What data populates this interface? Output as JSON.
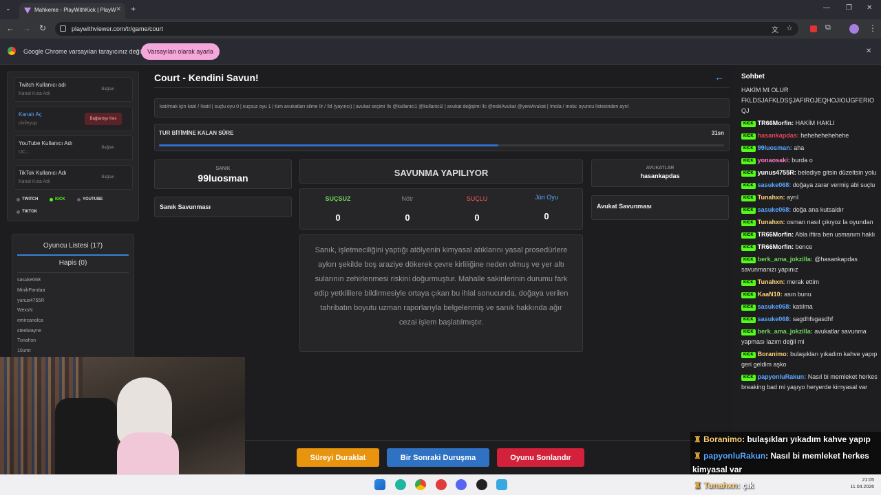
{
  "browser": {
    "tab_title": "Mahkeme - PlayWithKick | PlayW",
    "url": "playwithviewer.com/tr/game/court",
    "info_text": "Google Chrome varsayılan tarayıcınız değil",
    "set_default_label": "Varsayılan olarak ayarla"
  },
  "accounts": [
    {
      "title": "Twitch Kullanıcı adı",
      "sub": "Kanal Kısa Adı",
      "action": "Bağlan"
    },
    {
      "title": "Kanalı Aç",
      "sub": "civileyup",
      "action": "Bağlantıyı Kes"
    },
    {
      "title": "YouTube Kullanıcı Adı",
      "sub": "UC...",
      "action": "Bağlan"
    },
    {
      "title": "TikTok Kullanıcı Adı",
      "sub": "Kanal Kısa Adı",
      "action": "Bağlan"
    }
  ],
  "platforms": [
    "TWITCH",
    "KICK",
    "YOUTUBE",
    "TIKTOK"
  ],
  "players": {
    "list_label": "Oyuncu Listesi (17)",
    "jail_label": "Hapis (0)",
    "names": [
      "sasuke068",
      "MinikPandaa",
      "yunus4755R",
      "WexsN",
      "emircanolca",
      "steelwayne",
      "Tunahsn",
      "10umt"
    ]
  },
  "court": {
    "title": "Court - Kendini Savun!",
    "commands": "katılmak için katıl / !katıl | suçlu oyu 0 | suçsuz oyu 1 | tüm avukatları silme !lr / !ld (yayıncı) | avukat seçimi !ls @kullanici1 @kullanici2 | avukat değişimi !lc @eskiAvukat @yeniAvukat | !mola / mola: oyuncu listesinden ayrıl",
    "timer_label": "TUR BİTİMİNE KALAN SÜRE",
    "timer_value": "31sn",
    "timer_progress": 0.6,
    "defendant_label": "SANIK",
    "defendant_name": "99luosman",
    "defendant_defense": "Sanık Savunması",
    "phase": "SAVUNMA YAPILIYOR",
    "votes": [
      {
        "label": "SUÇSUZ",
        "value": "0",
        "color": "#6fd35a"
      },
      {
        "label": "Nötr",
        "value": "0",
        "color": "#888888"
      },
      {
        "label": "SUÇLU",
        "value": "0",
        "color": "#ff5a5a"
      },
      {
        "label": "Jüri Oyu",
        "value": "0",
        "color": "#5aa8ff"
      }
    ],
    "lawyers_label": "AVUKATLAR",
    "lawyer_name": "hasankapdas",
    "lawyer_defense": "Avukat Savunması",
    "case_text": "Sanık, işletmeciliğini yaptığı atölyenin kimyasal atıklarını yasal prosedürlere aykırı şekilde boş araziye dökerek çevre kirliliğine neden olmuş ve yer altı sularının zehirlenmesi riskini doğurmuştur. Mahalle sakinlerinin durumu fark edip yetkililere bildirmesiyle ortaya çıkan bu ihlal sonucunda, doğaya verilen tahribatın boyutu uzman raporlarıyla belgelenmiş ve sanık hakkında ağır cezai işlem başlatılmıştır.",
    "pause_label": "Süreyi Duraklat",
    "next_label": "Bir Sonraki Duruşma",
    "end_label": "Oyunu Sonlandır"
  },
  "chat": {
    "title": "Sohbet",
    "top_text": "HAKİM MI OLUR FKLDSJAFKLDSŞJAFIROJEQHOJIOIJGFERIO QJ",
    "messages": [
      {
        "user": "TR66Morfin",
        "color": "#ffffff",
        "text": "HAKİM HAKLI"
      },
      {
        "user": "hasankapdas",
        "color": "#e0455a",
        "text": "hehehehehehehe"
      },
      {
        "user": "99luosman",
        "color": "#5aa8ff",
        "text": "aha"
      },
      {
        "user": "yonaosaki",
        "color": "#ff7ac6",
        "text": "burda o"
      },
      {
        "user": "yunus4755R",
        "color": "#ffffff",
        "text": "belediye gitsin düzeltsin yolu"
      },
      {
        "user": "sasuke068",
        "color": "#5aa8ff",
        "text": "doğaya zarar vermiş abi suçlu"
      },
      {
        "user": "Tunahxn",
        "color": "#ffd27a",
        "text": "ayrıl"
      },
      {
        "user": "sasuke068",
        "color": "#5aa8ff",
        "text": "doğa ana kutsaldır"
      },
      {
        "user": "Tunahxn",
        "color": "#ffd27a",
        "text": "osman nasıl çıkıyoz la oyundan"
      },
      {
        "user": "TR66Morfin",
        "color": "#ffffff",
        "text": "Abla iftira ben usmanım haklı"
      },
      {
        "user": "TR66Morfin",
        "color": "#ffffff",
        "text": "bence"
      },
      {
        "user": "berk_ama_jokzilla",
        "color": "#6fd35a",
        "text": "@hasankapdas savunmanızı yapınız"
      },
      {
        "user": "Tunahxn",
        "color": "#ffd27a",
        "text": "merak ettim"
      },
      {
        "user": "KaaN10",
        "color": "#ffd27a",
        "text": "asın bunu"
      },
      {
        "user": "sasuke068",
        "color": "#5aa8ff",
        "text": "katılma"
      },
      {
        "user": "sasuke068",
        "color": "#5aa8ff",
        "text": "sagdhfsgasdhf"
      },
      {
        "user": "berk_ama_jokzilla",
        "color": "#6fd35a",
        "text": "avukatlar savunma yapması lazım değil mi"
      },
      {
        "user": "Boranimo",
        "color": "#ffd27a",
        "text": "bulaşıkları yıkadım kahve yapıp geri geldim aşko"
      },
      {
        "user": "papyonluRakun",
        "color": "#5aa8ff",
        "text": "Nasıl bi memleket herkes breaking bad mi yaşıyo heryerde kimyasal var"
      }
    ],
    "badge": "KICK"
  },
  "overlay": [
    {
      "user": "Boranimo",
      "text": ": bulaşıkları yıkadım kahve yapıp"
    },
    {
      "user": "papyonluRakun",
      "text": ": Nasıl bi memleket herkes"
    },
    {
      "user": "",
      "text": "kimyasal var"
    },
    {
      "user": "Tunahxn",
      "text": ": çık"
    }
  ],
  "taskbar": {
    "time": "21:05",
    "date": "11.04.2026"
  }
}
